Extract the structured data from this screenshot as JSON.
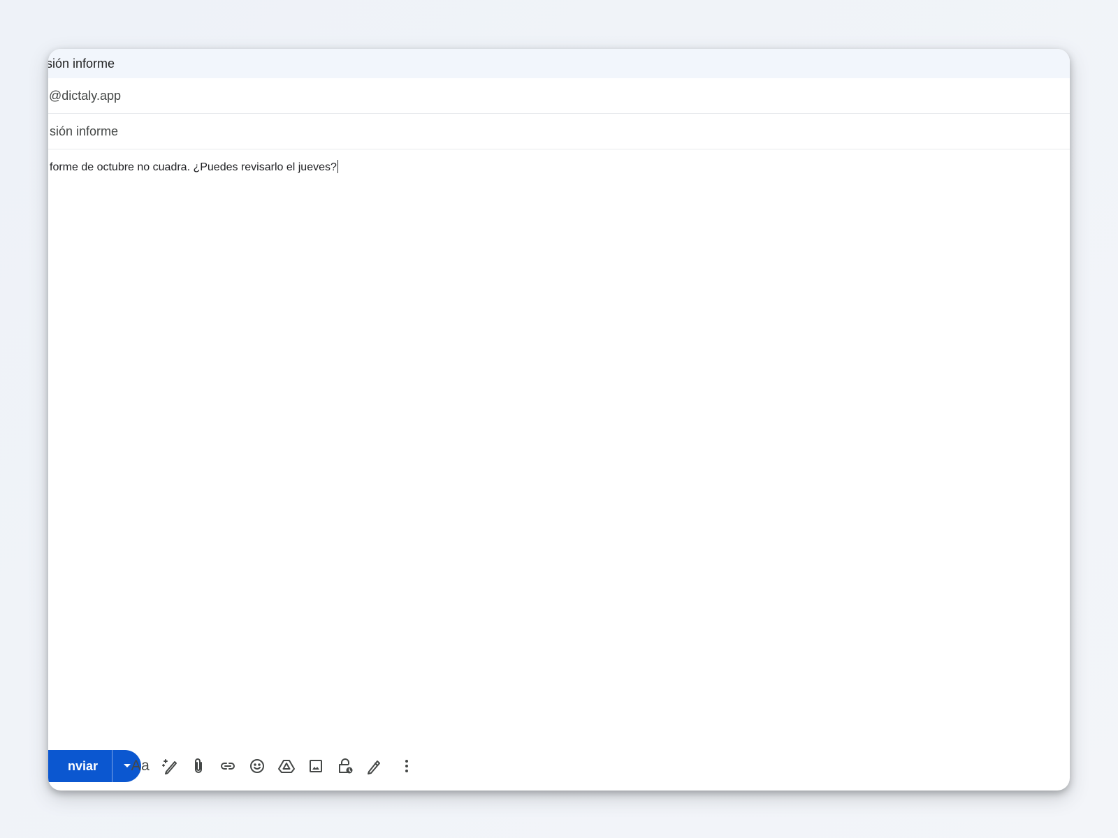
{
  "compose": {
    "title": "sión informe",
    "to_value": "@dictaly.app",
    "subject_value": "sión informe",
    "body_text": "forme de octubre no cuadra. ¿Puedes revisarlo el jueves?"
  },
  "toolbar": {
    "send_label": "nviar",
    "format_label": "Aa",
    "icons": [
      "dropdown-arrow-icon",
      "formatting-options-icon",
      "ai-write-icon",
      "attach-file-icon",
      "insert-link-icon",
      "emoji-icon",
      "google-drive-icon",
      "insert-photo-icon",
      "confidential-mode-icon",
      "signature-icon",
      "more-options-icon"
    ]
  },
  "colors": {
    "send_button": "#0b57d0",
    "title_bar": "#f2f6fc",
    "icon": "#444746",
    "page_background": "#eef2f8"
  }
}
